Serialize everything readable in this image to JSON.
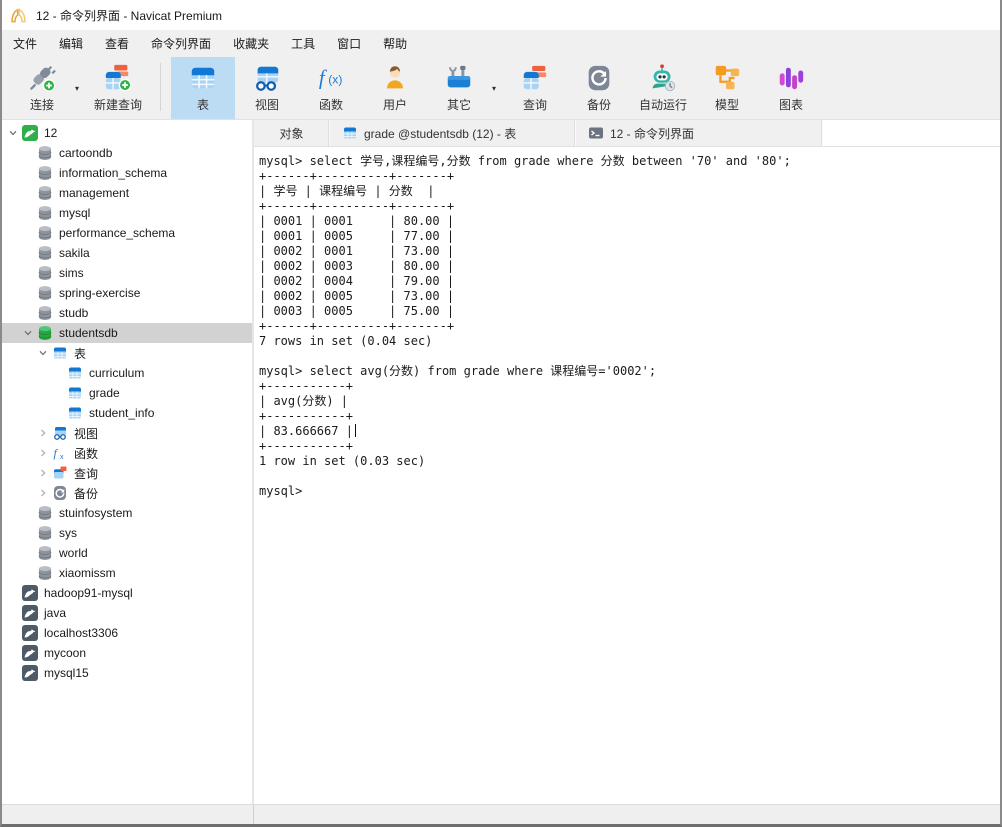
{
  "window": {
    "title": "12 - 命令列界面 - Navicat Premium"
  },
  "menu_bar": {
    "items": [
      "文件",
      "编辑",
      "查看",
      "命令列界面",
      "收藏夹",
      "工具",
      "窗口",
      "帮助"
    ]
  },
  "toolbar": {
    "buttons": [
      {
        "label": "连接",
        "icon": "connection-icon",
        "dropdown": true
      },
      {
        "label": "新建查询",
        "icon": "new-query-icon",
        "separator_after": true
      },
      {
        "label": "表",
        "icon": "table-icon",
        "active": true
      },
      {
        "label": "视图",
        "icon": "view-icon"
      },
      {
        "label": "函数",
        "icon": "function-icon"
      },
      {
        "label": "用户",
        "icon": "user-icon"
      },
      {
        "label": "其它",
        "icon": "others-icon",
        "dropdown": true
      },
      {
        "label": "查询",
        "icon": "query-icon"
      },
      {
        "label": "备份",
        "icon": "backup-icon"
      },
      {
        "label": "自动运行",
        "icon": "automation-icon"
      },
      {
        "label": "模型",
        "icon": "model-icon"
      },
      {
        "label": "图表",
        "icon": "chart-icon"
      }
    ]
  },
  "sidebar": {
    "tree": [
      {
        "level": 0,
        "arrow": "down",
        "icon": "mysql-connection-open-icon",
        "label": "12"
      },
      {
        "level": 1,
        "arrow": "",
        "icon": "database-icon",
        "label": "cartoondb"
      },
      {
        "level": 1,
        "arrow": "",
        "icon": "database-icon",
        "label": "information_schema"
      },
      {
        "level": 1,
        "arrow": "",
        "icon": "database-icon",
        "label": "management"
      },
      {
        "level": 1,
        "arrow": "",
        "icon": "database-icon",
        "label": "mysql"
      },
      {
        "level": 1,
        "arrow": "",
        "icon": "database-icon",
        "label": "performance_schema"
      },
      {
        "level": 1,
        "arrow": "",
        "icon": "database-icon",
        "label": "sakila"
      },
      {
        "level": 1,
        "arrow": "",
        "icon": "database-icon",
        "label": "sims"
      },
      {
        "level": 1,
        "arrow": "",
        "icon": "database-icon",
        "label": "spring-exercise"
      },
      {
        "level": 1,
        "arrow": "",
        "icon": "database-icon",
        "label": "studb"
      },
      {
        "level": 1,
        "arrow": "down",
        "icon": "database-open-icon",
        "label": "studentsdb",
        "selected": true
      },
      {
        "level": 2,
        "arrow": "down",
        "icon": "tables-group-icon",
        "label": "表"
      },
      {
        "level": 3,
        "arrow": "",
        "icon": "table-item-icon",
        "label": "curriculum"
      },
      {
        "level": 3,
        "arrow": "",
        "icon": "table-item-icon",
        "label": "grade"
      },
      {
        "level": 3,
        "arrow": "",
        "icon": "table-item-icon",
        "label": "student_info"
      },
      {
        "level": 2,
        "arrow": "right",
        "icon": "views-group-icon",
        "label": "视图"
      },
      {
        "level": 2,
        "arrow": "right",
        "icon": "functions-group-icon",
        "label": "函数"
      },
      {
        "level": 2,
        "arrow": "right",
        "icon": "queries-group-icon",
        "label": "查询"
      },
      {
        "level": 2,
        "arrow": "right",
        "icon": "backups-group-icon",
        "label": "备份"
      },
      {
        "level": 1,
        "arrow": "",
        "icon": "database-icon",
        "label": "stuinfosystem"
      },
      {
        "level": 1,
        "arrow": "",
        "icon": "database-icon",
        "label": "sys"
      },
      {
        "level": 1,
        "arrow": "",
        "icon": "database-icon",
        "label": "world"
      },
      {
        "level": 1,
        "arrow": "",
        "icon": "database-icon",
        "label": "xiaomissm"
      },
      {
        "level": 0,
        "arrow": "",
        "icon": "mysql-connection-closed-icon",
        "label": "hadoop91-mysql"
      },
      {
        "level": 0,
        "arrow": "",
        "icon": "mysql-connection-closed-icon",
        "label": "java"
      },
      {
        "level": 0,
        "arrow": "",
        "icon": "mysql-connection-closed-icon",
        "label": "localhost3306"
      },
      {
        "level": 0,
        "arrow": "",
        "icon": "mysql-connection-closed-icon",
        "label": "mycoon"
      },
      {
        "level": 0,
        "arrow": "",
        "icon": "mysql-connection-closed-icon",
        "label": "mysql15"
      }
    ]
  },
  "tab_bar": {
    "tabs": [
      {
        "label": "对象"
      },
      {
        "label": "grade @studentsdb (12) - 表",
        "icon": "table-tab-icon"
      },
      {
        "label": "12 - 命令列界面",
        "icon": "terminal-tab-icon",
        "active": true
      }
    ]
  },
  "terminal": {
    "cursor_line_index": 18,
    "lines": [
      "mysql> select 学号,课程编号,分数 from grade where 分数 between '70' and '80';",
      "+------+----------+-------+",
      "| 学号 | 课程编号 | 分数  |",
      "+------+----------+-------+",
      "| 0001 | 0001     | 80.00 |",
      "| 0001 | 0005     | 77.00 |",
      "| 0002 | 0001     | 73.00 |",
      "| 0002 | 0003     | 80.00 |",
      "| 0002 | 0004     | 79.00 |",
      "| 0002 | 0005     | 73.00 |",
      "| 0003 | 0005     | 75.00 |",
      "+------+----------+-------+",
      "7 rows in set (0.04 sec)",
      "",
      "mysql> select avg(分数) from grade where 课程编号='0002';",
      "+-----------+",
      "| avg(分数) |",
      "+-----------+",
      "| 83.666667 |",
      "+-----------+",
      "1 row in set (0.03 sec)",
      "",
      "mysql>"
    ]
  },
  "status_bar": {
    "text": ""
  },
  "colors": {
    "toolbar_active_bg": "#bcdcf4",
    "tree_selected_bg": "#d2d2d2",
    "table_icon_blue": "#1377d4",
    "mysql_green": "#2fae4a",
    "query_orange": "#f0603c",
    "backup_gray": "#7d8694",
    "automation_teal": "#37b6a8",
    "model_orange": "#f59b1e",
    "chart_purple": "#b03fd6",
    "chrome_gray": "#f0f0f0"
  }
}
